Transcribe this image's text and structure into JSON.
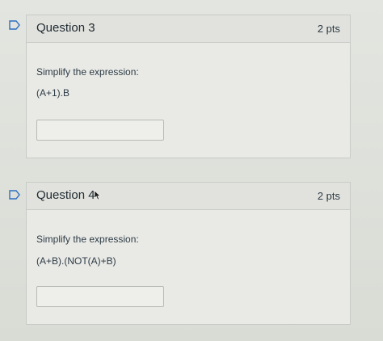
{
  "questions": [
    {
      "title": "Question 3",
      "points": "2 pts",
      "prompt": "Simplify the expression:",
      "expression": "(A+1).B",
      "answer_value": ""
    },
    {
      "title": "Question 4",
      "points": "2 pts",
      "prompt": "Simplify the expression:",
      "expression": "(A+B).(NOT(A)+B)",
      "answer_value": ""
    }
  ],
  "colors": {
    "flag_outline": "#2d6fbf",
    "background": "#dfe1dc",
    "card": "#e9eae6",
    "border": "#c8cbc7"
  },
  "icons": [
    "flag-icon",
    "mouse-pointer-icon"
  ]
}
